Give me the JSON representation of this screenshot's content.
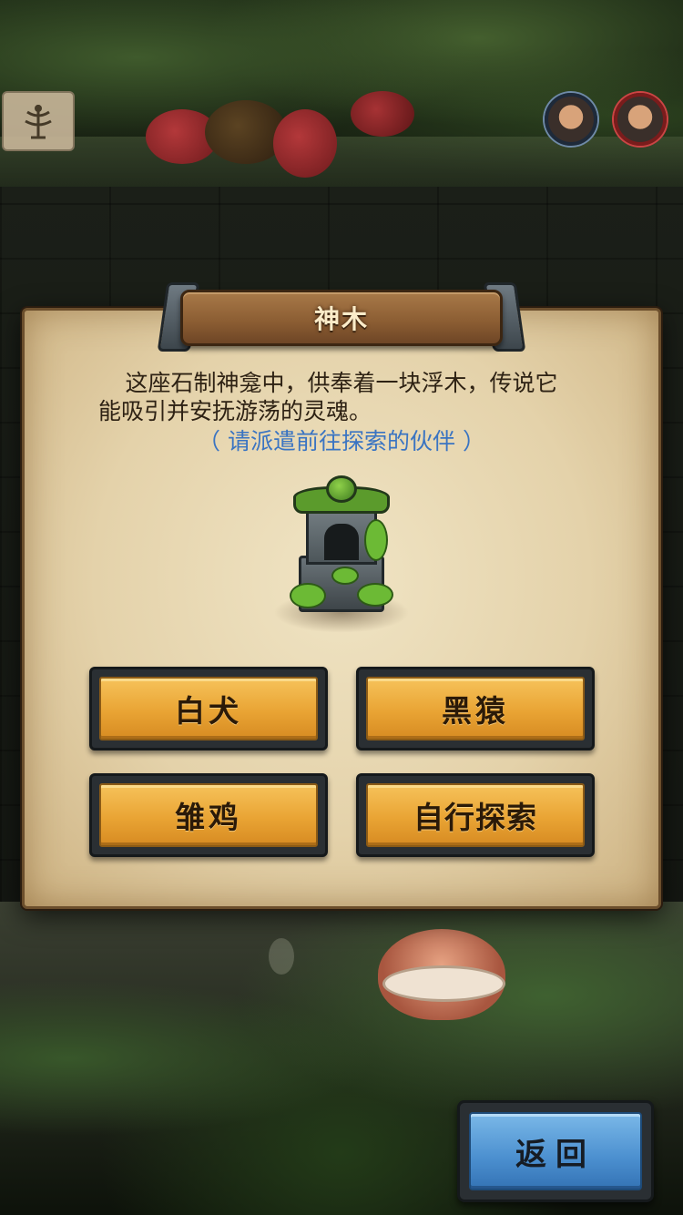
{
  "dialog": {
    "title": "神木",
    "description_line1": "这座石制神龛中，供奉着一块浮木，传说它",
    "description_line2": "能吸引并安抚游荡的灵魂。",
    "hint": "（ 请派遣前往探索的伙伴 ）",
    "illustration_icon": "moss-covered-stone-shrine-icon"
  },
  "options": {
    "dog": "白犬",
    "monkey": "黑猿",
    "chick": "雏鸡",
    "self_explore": "自行探索"
  },
  "footer": {
    "back_label": "返回"
  },
  "colors": {
    "option_button": "#e9a434",
    "back_button": "#4b8fcf",
    "hint_text": "#3a74c2",
    "parchment": "#e4d2aa"
  }
}
